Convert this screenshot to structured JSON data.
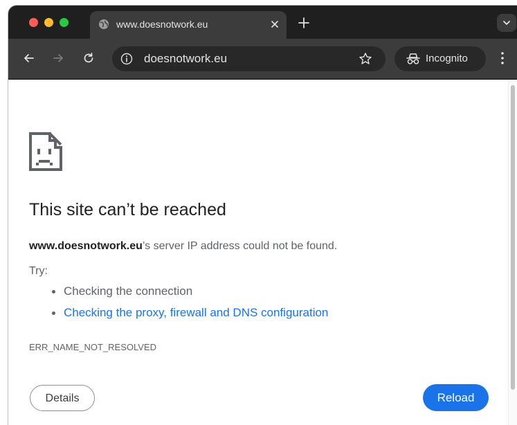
{
  "browser": {
    "tab": {
      "title": "www.doesnotwork.eu",
      "favicon": "globe-icon"
    },
    "toolbar": {
      "url": "doesnotwork.eu",
      "incognito_label": "Incognito"
    }
  },
  "error_page": {
    "heading": "This site can’t be reached",
    "host": "www.doesnotwork.eu",
    "description_suffix": "’s server IP address could not be found.",
    "try_label": "Try:",
    "suggestions": [
      {
        "text": "Checking the connection",
        "link": false
      },
      {
        "text": "Checking the proxy, firewall and DNS configuration",
        "link": true
      }
    ],
    "error_code": "ERR_NAME_NOT_RESOLVED",
    "details_button": "Details",
    "reload_button": "Reload"
  },
  "colors": {
    "accent": "#1a73e8",
    "tabstrip_bg": "#1f1f1f",
    "toolbar_bg": "#3c3c3c"
  }
}
